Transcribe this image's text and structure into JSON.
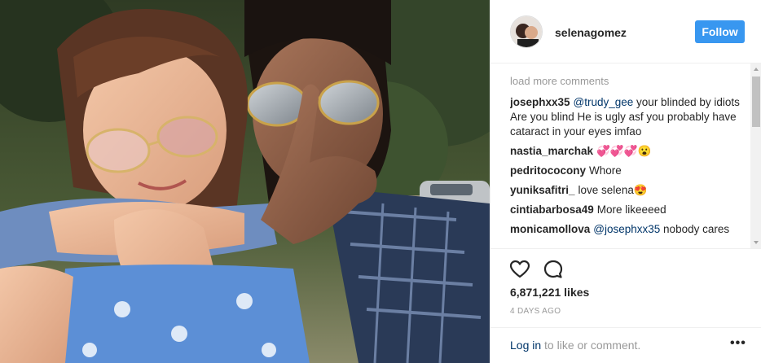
{
  "post": {
    "username": "selenagomez",
    "follow_label": "Follow",
    "load_more": "load more comments",
    "comments": [
      {
        "author": "josephxx35",
        "mention": "@trudy_gee",
        "text": " your blinded by idiots Are you blind He is ugly asf you probably have cataract in your eyes imfao"
      },
      {
        "author": "nastia_marchak",
        "mention": "",
        "text": "💞💞💞😮"
      },
      {
        "author": "pedritococony",
        "mention": "",
        "text": "Whore"
      },
      {
        "author": "yuniksafitri_",
        "mention": "",
        "text": "love selena😍"
      },
      {
        "author": "cintiabarbosa49",
        "mention": "",
        "text": "More likeeeed"
      },
      {
        "author": "monicamollova",
        "mention": "@josephxx35",
        "text": " nobody cares"
      }
    ],
    "likes": "6,871,221 likes",
    "time": "4 DAYS AGO",
    "login": {
      "link": "Log in",
      "rest": " to like or comment."
    },
    "more_glyph": "•••"
  },
  "icons": {
    "like": "heart-outline-icon",
    "comment": "speech-bubble-icon",
    "more": "ellipsis-icon"
  },
  "colors": {
    "follow_bg": "#3897f0",
    "link": "#003569",
    "muted": "#999999"
  }
}
